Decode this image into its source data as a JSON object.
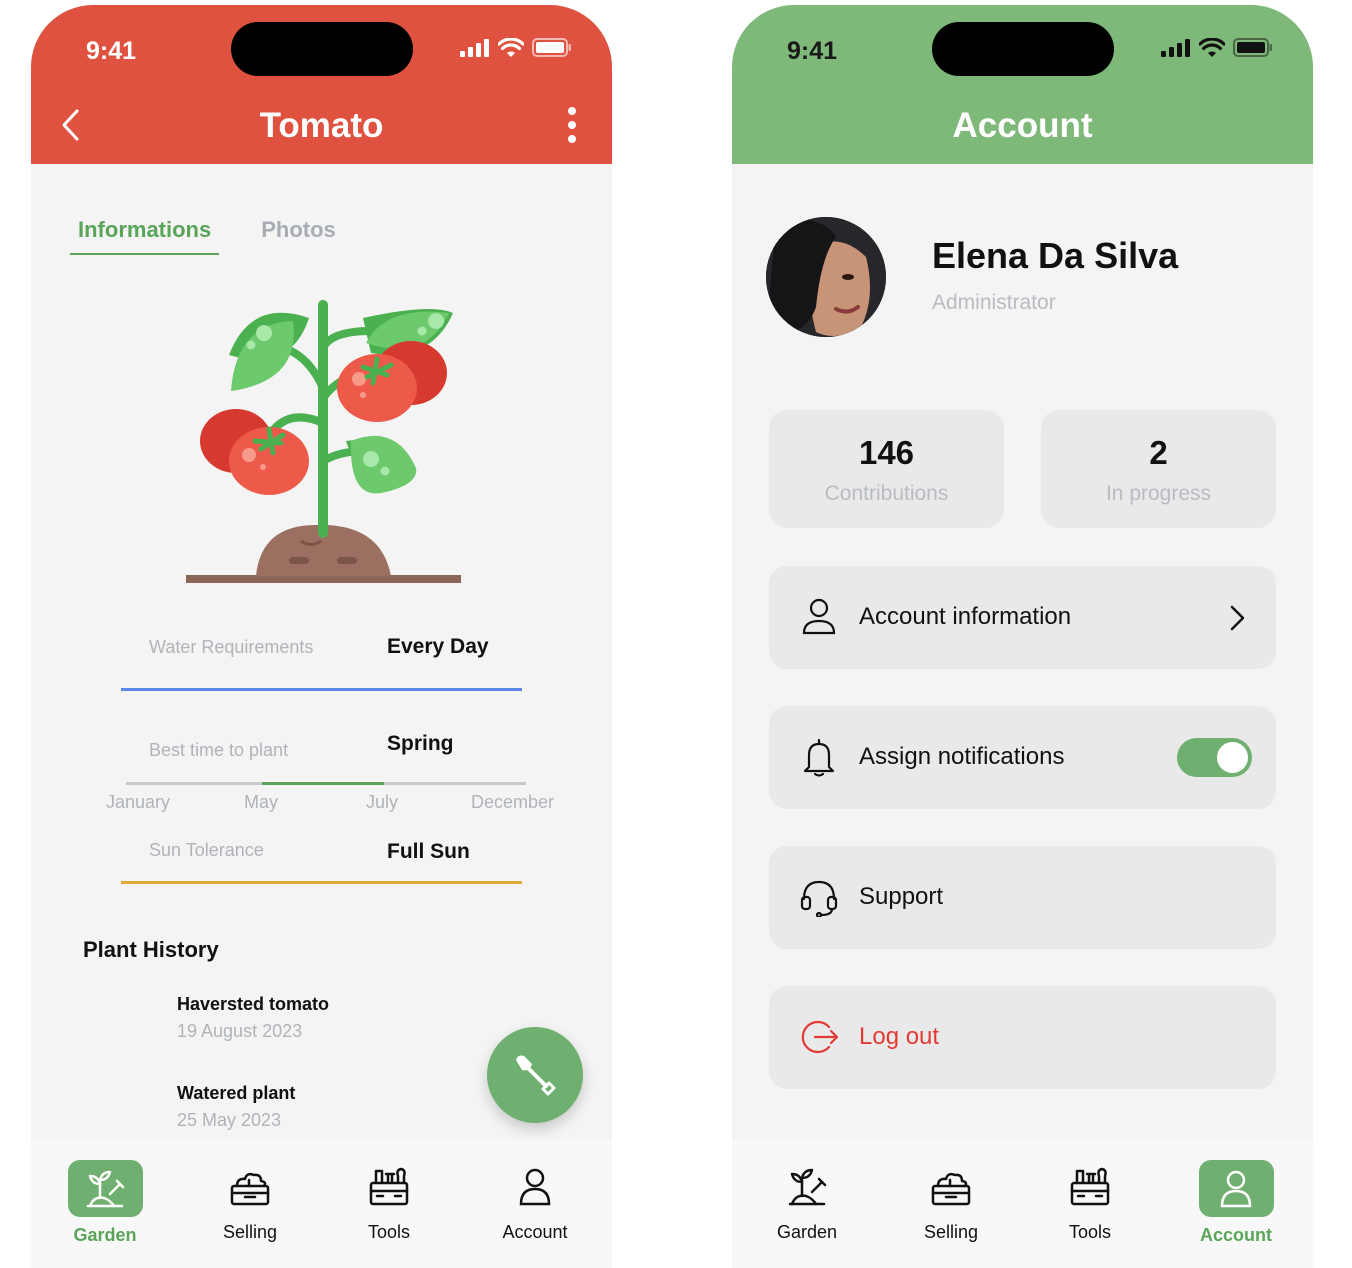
{
  "status_bar": {
    "time": "9:41"
  },
  "colors": {
    "tomato_header": "#e05240",
    "account_header": "#7eb97a",
    "accent_green": "#6fb070",
    "logout_red": "#e23b35",
    "water_blue": "#5b87e8",
    "sun_orange": "#e1a93b"
  },
  "plant_screen": {
    "title": "Tomato",
    "tabs": [
      {
        "label": "Informations",
        "active": true
      },
      {
        "label": "Photos",
        "active": false
      }
    ],
    "water": {
      "label": "Water Requirements",
      "value": "Every Day"
    },
    "planting": {
      "label": "Best time to plant",
      "value": "Spring",
      "months": [
        "January",
        "May",
        "July",
        "December"
      ]
    },
    "sun": {
      "label": "Sun Tolerance",
      "value": "Full Sun"
    },
    "history": {
      "title": "Plant History",
      "entries": [
        {
          "event": "Haversted tomato",
          "date": "19 August 2023"
        },
        {
          "event": "Watered plant",
          "date": "25 May 2023"
        }
      ]
    },
    "fab_icon": "shovel-icon"
  },
  "account_screen": {
    "title": "Account",
    "profile": {
      "name": "Elena Da Silva",
      "role": "Administrator"
    },
    "stats": [
      {
        "value": "146",
        "label": "Contributions"
      },
      {
        "value": "2",
        "label": "In progress"
      }
    ],
    "menu": [
      {
        "label": "Account information",
        "icon": "user-icon"
      },
      {
        "label": "Assign notifications",
        "icon": "bell-icon",
        "toggle_on": true
      },
      {
        "label": "Support",
        "icon": "headset-icon"
      },
      {
        "label": "Log out",
        "icon": "logout-icon"
      }
    ]
  },
  "nav": {
    "items": [
      {
        "label": "Garden",
        "icon": "garden-icon"
      },
      {
        "label": "Selling",
        "icon": "selling-icon"
      },
      {
        "label": "Tools",
        "icon": "tools-icon"
      },
      {
        "label": "Account",
        "icon": "account-icon"
      }
    ]
  }
}
